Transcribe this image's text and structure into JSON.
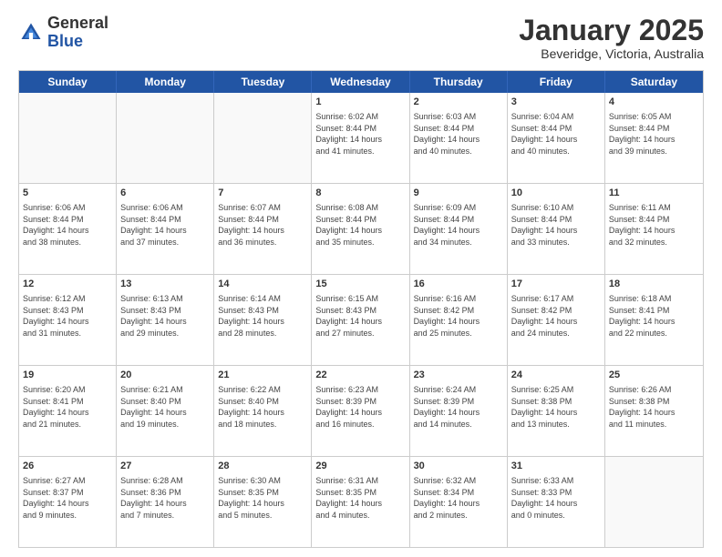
{
  "logo": {
    "general": "General",
    "blue": "Blue"
  },
  "title": {
    "month": "January 2025",
    "location": "Beveridge, Victoria, Australia"
  },
  "header_days": [
    "Sunday",
    "Monday",
    "Tuesday",
    "Wednesday",
    "Thursday",
    "Friday",
    "Saturday"
  ],
  "weeks": [
    [
      {
        "day": "",
        "info": ""
      },
      {
        "day": "",
        "info": ""
      },
      {
        "day": "",
        "info": ""
      },
      {
        "day": "1",
        "info": "Sunrise: 6:02 AM\nSunset: 8:44 PM\nDaylight: 14 hours\nand 41 minutes."
      },
      {
        "day": "2",
        "info": "Sunrise: 6:03 AM\nSunset: 8:44 PM\nDaylight: 14 hours\nand 40 minutes."
      },
      {
        "day": "3",
        "info": "Sunrise: 6:04 AM\nSunset: 8:44 PM\nDaylight: 14 hours\nand 40 minutes."
      },
      {
        "day": "4",
        "info": "Sunrise: 6:05 AM\nSunset: 8:44 PM\nDaylight: 14 hours\nand 39 minutes."
      }
    ],
    [
      {
        "day": "5",
        "info": "Sunrise: 6:06 AM\nSunset: 8:44 PM\nDaylight: 14 hours\nand 38 minutes."
      },
      {
        "day": "6",
        "info": "Sunrise: 6:06 AM\nSunset: 8:44 PM\nDaylight: 14 hours\nand 37 minutes."
      },
      {
        "day": "7",
        "info": "Sunrise: 6:07 AM\nSunset: 8:44 PM\nDaylight: 14 hours\nand 36 minutes."
      },
      {
        "day": "8",
        "info": "Sunrise: 6:08 AM\nSunset: 8:44 PM\nDaylight: 14 hours\nand 35 minutes."
      },
      {
        "day": "9",
        "info": "Sunrise: 6:09 AM\nSunset: 8:44 PM\nDaylight: 14 hours\nand 34 minutes."
      },
      {
        "day": "10",
        "info": "Sunrise: 6:10 AM\nSunset: 8:44 PM\nDaylight: 14 hours\nand 33 minutes."
      },
      {
        "day": "11",
        "info": "Sunrise: 6:11 AM\nSunset: 8:44 PM\nDaylight: 14 hours\nand 32 minutes."
      }
    ],
    [
      {
        "day": "12",
        "info": "Sunrise: 6:12 AM\nSunset: 8:43 PM\nDaylight: 14 hours\nand 31 minutes."
      },
      {
        "day": "13",
        "info": "Sunrise: 6:13 AM\nSunset: 8:43 PM\nDaylight: 14 hours\nand 29 minutes."
      },
      {
        "day": "14",
        "info": "Sunrise: 6:14 AM\nSunset: 8:43 PM\nDaylight: 14 hours\nand 28 minutes."
      },
      {
        "day": "15",
        "info": "Sunrise: 6:15 AM\nSunset: 8:43 PM\nDaylight: 14 hours\nand 27 minutes."
      },
      {
        "day": "16",
        "info": "Sunrise: 6:16 AM\nSunset: 8:42 PM\nDaylight: 14 hours\nand 25 minutes."
      },
      {
        "day": "17",
        "info": "Sunrise: 6:17 AM\nSunset: 8:42 PM\nDaylight: 14 hours\nand 24 minutes."
      },
      {
        "day": "18",
        "info": "Sunrise: 6:18 AM\nSunset: 8:41 PM\nDaylight: 14 hours\nand 22 minutes."
      }
    ],
    [
      {
        "day": "19",
        "info": "Sunrise: 6:20 AM\nSunset: 8:41 PM\nDaylight: 14 hours\nand 21 minutes."
      },
      {
        "day": "20",
        "info": "Sunrise: 6:21 AM\nSunset: 8:40 PM\nDaylight: 14 hours\nand 19 minutes."
      },
      {
        "day": "21",
        "info": "Sunrise: 6:22 AM\nSunset: 8:40 PM\nDaylight: 14 hours\nand 18 minutes."
      },
      {
        "day": "22",
        "info": "Sunrise: 6:23 AM\nSunset: 8:39 PM\nDaylight: 14 hours\nand 16 minutes."
      },
      {
        "day": "23",
        "info": "Sunrise: 6:24 AM\nSunset: 8:39 PM\nDaylight: 14 hours\nand 14 minutes."
      },
      {
        "day": "24",
        "info": "Sunrise: 6:25 AM\nSunset: 8:38 PM\nDaylight: 14 hours\nand 13 minutes."
      },
      {
        "day": "25",
        "info": "Sunrise: 6:26 AM\nSunset: 8:38 PM\nDaylight: 14 hours\nand 11 minutes."
      }
    ],
    [
      {
        "day": "26",
        "info": "Sunrise: 6:27 AM\nSunset: 8:37 PM\nDaylight: 14 hours\nand 9 minutes."
      },
      {
        "day": "27",
        "info": "Sunrise: 6:28 AM\nSunset: 8:36 PM\nDaylight: 14 hours\nand 7 minutes."
      },
      {
        "day": "28",
        "info": "Sunrise: 6:30 AM\nSunset: 8:35 PM\nDaylight: 14 hours\nand 5 minutes."
      },
      {
        "day": "29",
        "info": "Sunrise: 6:31 AM\nSunset: 8:35 PM\nDaylight: 14 hours\nand 4 minutes."
      },
      {
        "day": "30",
        "info": "Sunrise: 6:32 AM\nSunset: 8:34 PM\nDaylight: 14 hours\nand 2 minutes."
      },
      {
        "day": "31",
        "info": "Sunrise: 6:33 AM\nSunset: 8:33 PM\nDaylight: 14 hours\nand 0 minutes."
      },
      {
        "day": "",
        "info": ""
      }
    ]
  ]
}
